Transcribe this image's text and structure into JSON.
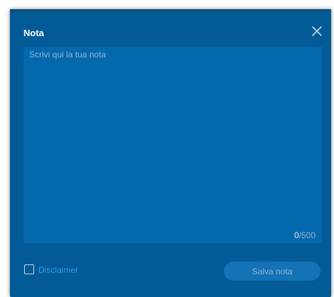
{
  "modal": {
    "title": "Nota",
    "close_icon": "close-icon"
  },
  "note": {
    "placeholder": "Scrivi qui la tua nota",
    "value": "",
    "char_count": "0",
    "char_max": "/500"
  },
  "footer": {
    "disclaimer_label": "Disclaimer",
    "save_label": "Salva nota"
  },
  "colors": {
    "modal_background": "#025a96",
    "textarea_background": "#0468ad",
    "link": "#2f9ee5",
    "button_disabled": "#1473b6"
  }
}
